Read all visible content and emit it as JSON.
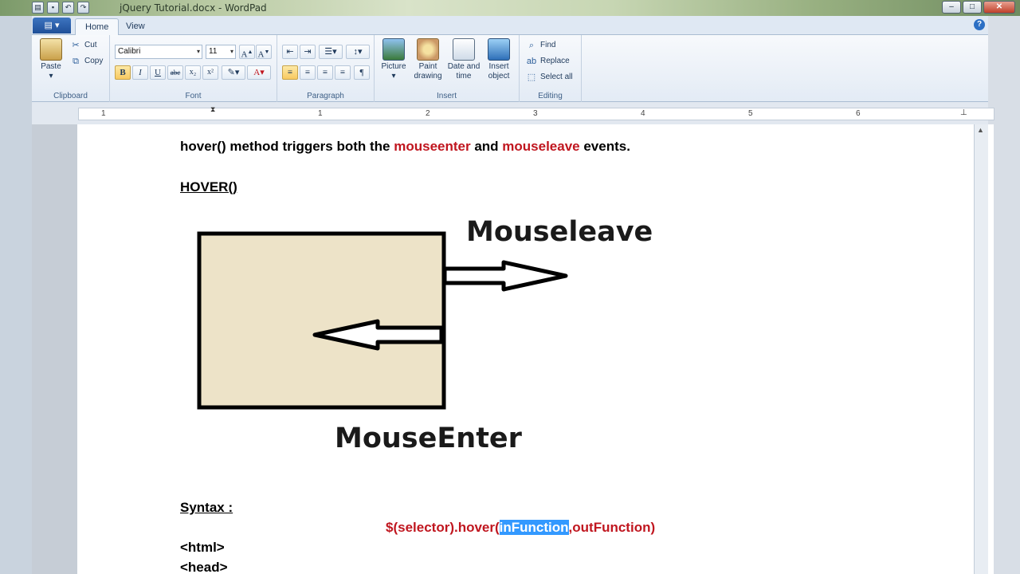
{
  "window": {
    "title": "jQuery Tutorial.docx - WordPad",
    "controls": [
      "–",
      "□",
      "✕"
    ]
  },
  "quick_access": [
    "save-icon",
    "undo-icon",
    "redo-icon"
  ],
  "tabs": [
    {
      "label": "Home",
      "active": true
    },
    {
      "label": "View",
      "active": false
    }
  ],
  "ribbon": {
    "clipboard": {
      "label": "Clipboard",
      "paste": "Paste",
      "cut": "Cut",
      "copy": "Copy"
    },
    "font": {
      "label": "Font",
      "family": "Calibri",
      "size": "11"
    },
    "paragraph": {
      "label": "Paragraph"
    },
    "insert": {
      "label": "Insert",
      "picture": "Picture",
      "paint_drawing": "Paint drawing",
      "date_time": "Date and time",
      "insert_object": "Insert object"
    },
    "editing": {
      "label": "Editing",
      "find": "Find",
      "replace": "Replace",
      "select_all": "Select all"
    }
  },
  "ruler": {
    "numbers": [
      "1",
      "1",
      "2",
      "3",
      "4",
      "5",
      "6"
    ]
  },
  "document": {
    "line1": {
      "prefix": "hover() method triggers both the ",
      "red1": "mouseenter",
      "mid": " and ",
      "red2": "mouseleave",
      "suffix": " events."
    },
    "heading": "HOVER()",
    "diagram": {
      "label_top": "Mouseleave",
      "label_bottom": "MouseEnter",
      "box_color": "#ede3c8"
    },
    "syntax_label": "Syntax :",
    "syntax": {
      "part1": "$(selector)",
      "part2": ".hover(",
      "selected": "inFunction",
      "part3": ",outFunction)"
    },
    "code_lines": [
      "<html>",
      "<head>"
    ]
  },
  "colors": {
    "accent_red": "#c0161f",
    "selection": "#3399ff"
  }
}
